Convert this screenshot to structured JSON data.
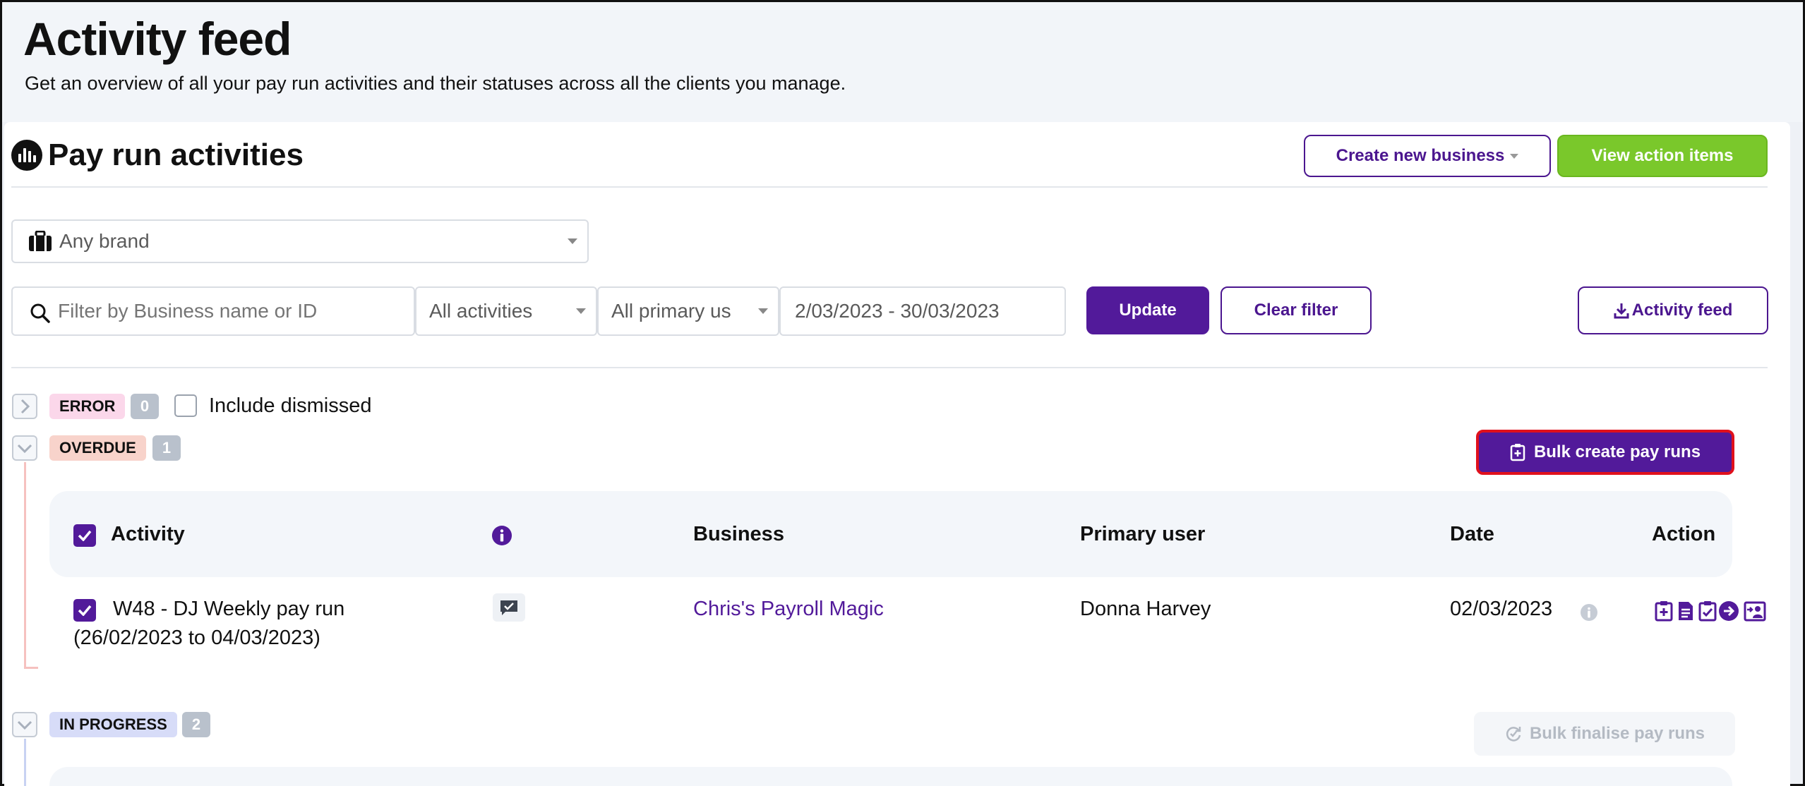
{
  "header": {
    "title": "Activity feed",
    "subtitle": "Get an overview of all your pay run activities and their statuses across all the clients you manage."
  },
  "panel": {
    "title": "Pay run activities",
    "create_business_label": "Create new business",
    "view_action_items_label": "View action items"
  },
  "filters": {
    "brand_value": "Any brand",
    "search_placeholder": "Filter by Business name or ID",
    "activities_value": "All activities",
    "primary_user_value": "All primary us",
    "date_range_value": "2/03/2023 - 30/03/2023",
    "update_label": "Update",
    "clear_filter_label": "Clear filter",
    "export_label": "Activity feed"
  },
  "groups": {
    "error": {
      "label": "ERROR",
      "count": "0",
      "include_dismissed_label": "Include dismissed"
    },
    "overdue": {
      "label": "OVERDUE",
      "count": "1",
      "bulk_label": "Bulk create pay runs"
    },
    "in_progress": {
      "label": "IN PROGRESS",
      "count": "2",
      "bulk_label": "Bulk finalise pay runs"
    }
  },
  "table": {
    "columns": {
      "activity": "Activity",
      "business": "Business",
      "primary_user": "Primary user",
      "date": "Date",
      "action": "Action"
    },
    "rows": [
      {
        "activity_line1": "W48 - DJ Weekly pay run",
        "activity_line2": "(26/02/2023 to 04/03/2023)",
        "business": "Chris's Payroll Magic",
        "primary_user": "Donna Harvey",
        "date": "02/03/2023"
      }
    ]
  },
  "colors": {
    "brand_purple": "#521a9a",
    "green": "#7ac82b",
    "error_badge": "#fbd7ea",
    "overdue_badge": "#f8d3cb",
    "in_progress_badge": "#d7dcf8",
    "highlight_border": "#e0101c"
  }
}
